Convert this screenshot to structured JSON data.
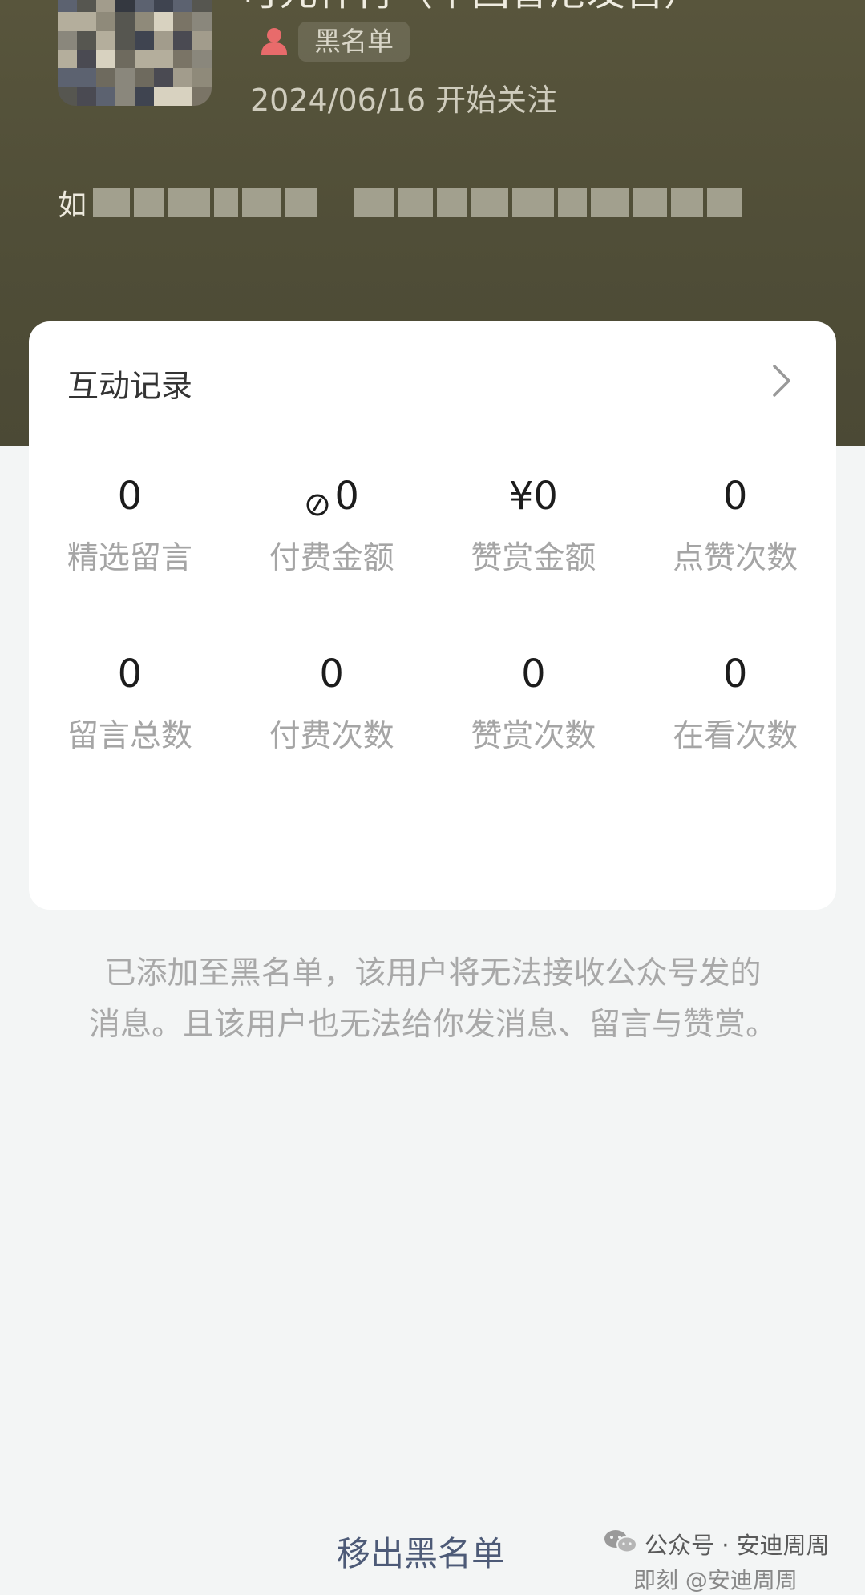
{
  "profile": {
    "name_fragment": "可元什肖（中国香港发售）",
    "blacklist_tag": "黑名单",
    "follow_date": "2024/06/16 开始关注",
    "bio_prefix": "如"
  },
  "interaction_card": {
    "title": "互动记录",
    "stats": [
      {
        "value": "0",
        "label": "精选留言"
      },
      {
        "value": "0",
        "label": "付费金额",
        "icon": "coin-icon"
      },
      {
        "value": "¥0",
        "label": "赞赏金额"
      },
      {
        "value": "0",
        "label": "点赞次数"
      },
      {
        "value": "0",
        "label": "留言总数"
      },
      {
        "value": "0",
        "label": "付费次数"
      },
      {
        "value": "0",
        "label": "赞赏次数"
      },
      {
        "value": "0",
        "label": "在看次数"
      }
    ]
  },
  "notice": {
    "line1": "已添加至黑名单，该用户将无法接收公众号发的",
    "line2": "消息。且该用户也无法给你发消息、留言与赞赏。"
  },
  "actions": {
    "remove_label": "移出黑名单"
  },
  "watermark": {
    "text": "公众号 · 安迪周周",
    "subtext": "即刻 @安迪周周"
  },
  "colors": {
    "header_bg": "#54523a",
    "page_bg": "#f3f5f5",
    "tag_icon": "#e86b6b",
    "link_blue": "#4d5a77"
  }
}
